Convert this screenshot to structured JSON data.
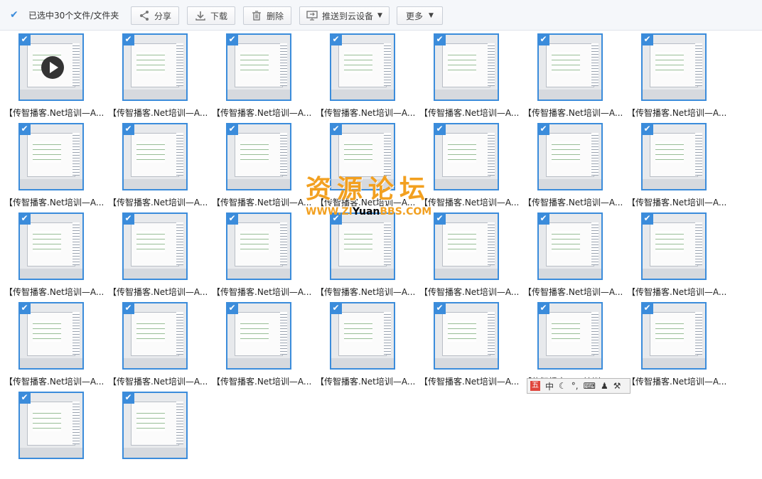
{
  "toolbar": {
    "select_all_label": "已选中30个文件/文件夹",
    "share_label": "分享",
    "download_label": "下载",
    "delete_label": "删除",
    "push_label": "推送到云设备",
    "more_label": "更多"
  },
  "file_name": "【传智播客.Net培训—A...",
  "files_total_visible": 30,
  "watermark": {
    "title": "资源论坛",
    "url_left": "WWW.ZI",
    "url_mid": "Yuan",
    "url_right": "BBS.COM"
  },
  "ime": {
    "logo": "五",
    "mode": "中"
  },
  "colors": {
    "accent": "#3b8cdb",
    "watermark": "#f2a020"
  }
}
